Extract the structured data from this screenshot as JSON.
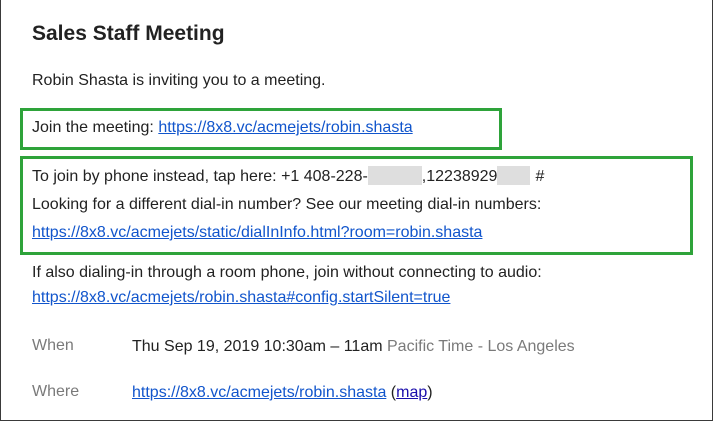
{
  "title": "Sales Staff Meeting",
  "invite_text": "Robin Shasta is inviting you to a meeting.",
  "join": {
    "label": "Join the meeting:",
    "url": "https://8x8.vc/acmejets/robin.shasta"
  },
  "phone": {
    "label": "To join by phone instead, tap here: +1 408-228-",
    "mid": ",12238929",
    "suffix": "#",
    "different_label": "Looking for a different dial-in number? See our meeting dial-in numbers:",
    "dial_in_url": "https://8x8.vc/acmejets/static/dialInInfo.html?room=robin.shasta"
  },
  "room_phone": {
    "label": "If also dialing-in through a room phone, join without connecting to audio:",
    "url": "https://8x8.vc/acmejets/robin.shasta#config.startSilent=true"
  },
  "when": {
    "label": "When",
    "value": "Thu Sep 19, 2019 10:30am – 11am",
    "timezone": "Pacific Time - Los Angeles"
  },
  "where": {
    "label": "Where",
    "url": "https://8x8.vc/acmejets/robin.shasta",
    "open_paren": "(",
    "map_label": "map",
    "close_paren": ")"
  },
  "colors": {
    "highlight_box": "#2ea33a",
    "link": "#1155cc",
    "muted_text": "#7a7a7a",
    "redaction": "#dedede"
  }
}
